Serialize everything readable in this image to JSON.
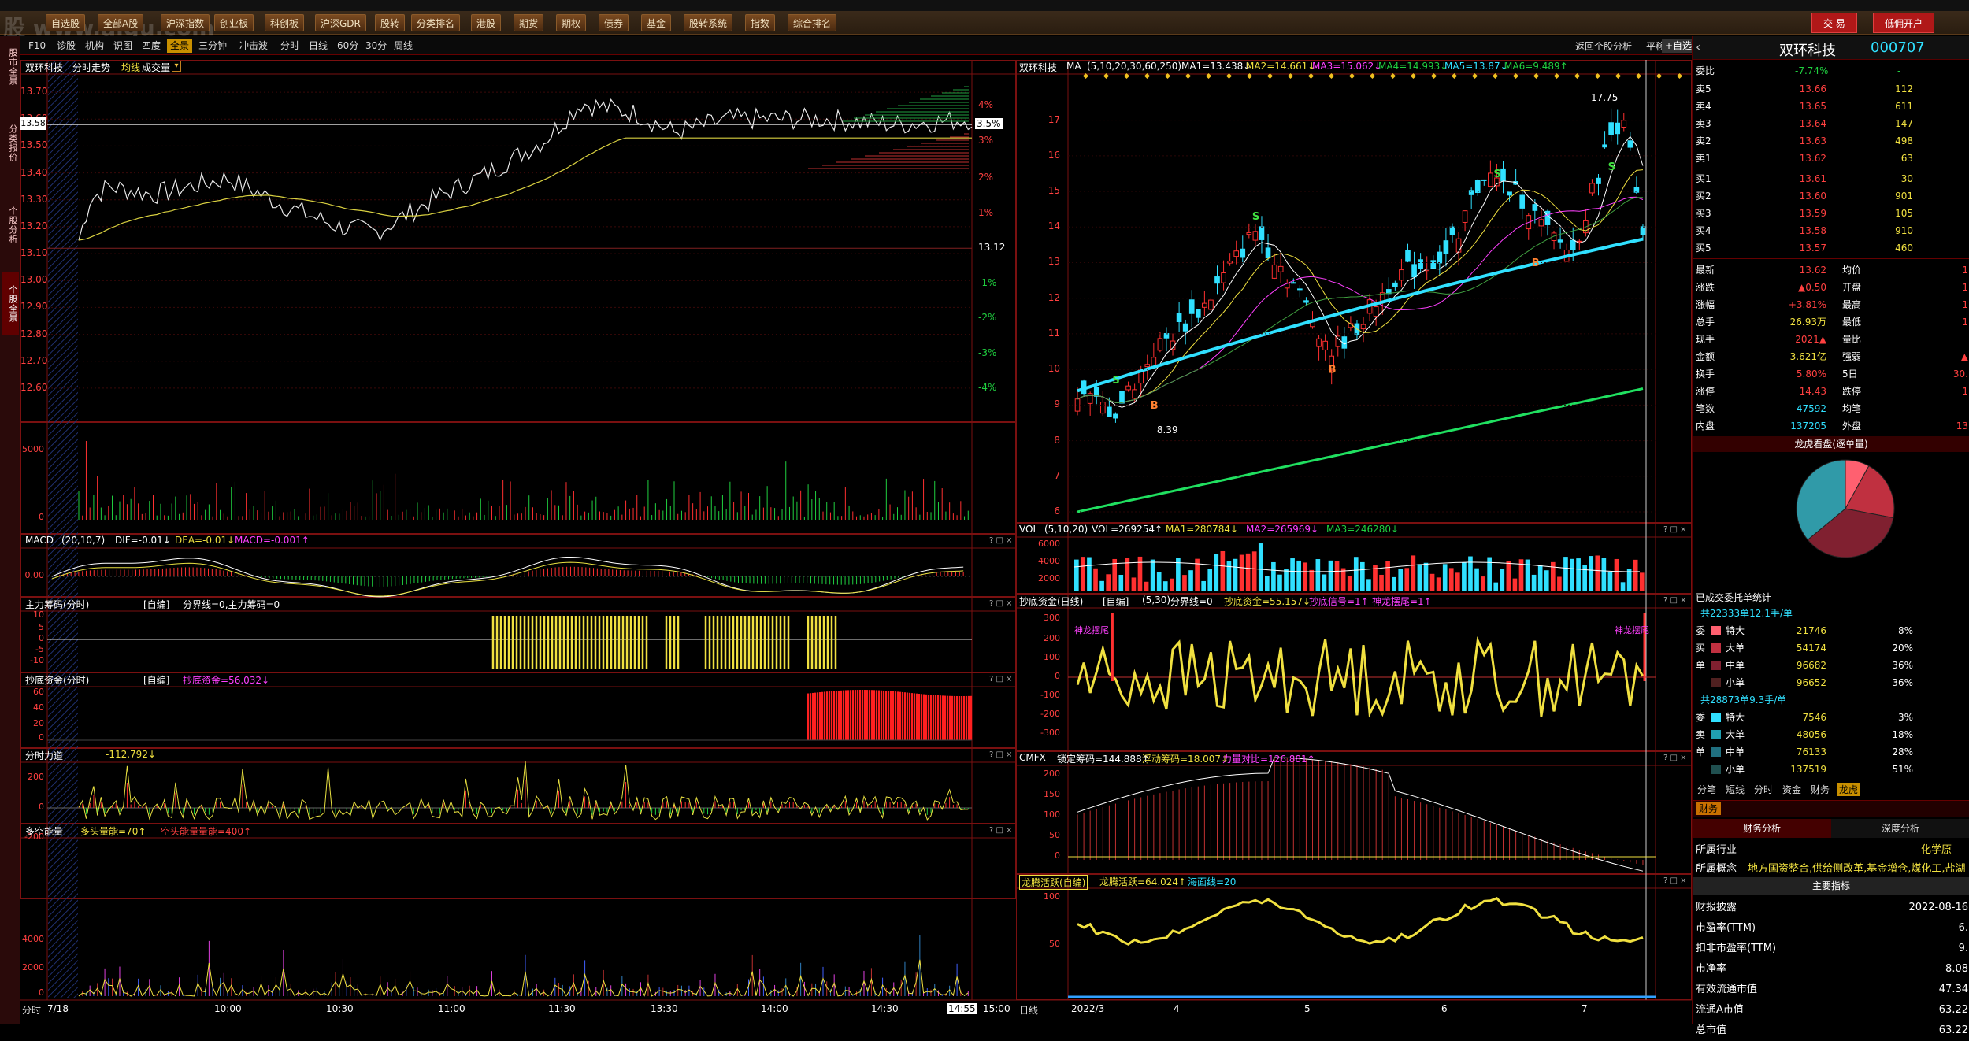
{
  "watermark": "股 www.aigu.com",
  "menubar": {
    "items": [
      "自选股",
      "全部A股",
      "沪深指数",
      "创业板",
      "科创板",
      "沪深GDR",
      "股转",
      "分类排名",
      "港股",
      "期货",
      "期权",
      "债券",
      "基金",
      "股转系统",
      "指数",
      "综合排名"
    ],
    "trade": "交 易",
    "open_account": "低佣开户"
  },
  "leftrail": [
    "股市全景",
    "分类报价",
    "个股分析",
    "个股全景"
  ],
  "tabs": {
    "items": [
      "F10",
      "诊股",
      "机构",
      "识图",
      "四度",
      "全景",
      "三分钟",
      "冲击波",
      "分时",
      "日线",
      "60分",
      "30分",
      "周线"
    ],
    "selected": "全景",
    "back_label": "返回个股分析",
    "flat_label": "平移",
    "self_select": "+自选"
  },
  "intraday": {
    "title_name": "双环科技",
    "title_type": "分时走势",
    "title_avg": "均线",
    "title_vol": "成交量",
    "price_ticks": [
      "13.70",
      "13.60",
      "13.50",
      "13.40",
      "13.30",
      "13.20",
      "13.10",
      "13.00",
      "12.90",
      "12.80",
      "12.70",
      "12.60"
    ],
    "current_price": "13.58",
    "pct_ticks": [
      "4%",
      "3.5%",
      "3%",
      "2%",
      "1%",
      "13.12",
      "-1%",
      "-2%",
      "-3%",
      "-4%"
    ],
    "vol_ticks": [
      "5000",
      "0"
    ],
    "times": [
      "7/18",
      "10:00",
      "10:30",
      "11:00",
      "11:30",
      "13:30",
      "14:00",
      "14:30",
      "14:55",
      "15:00"
    ],
    "period_label": "分时"
  },
  "macd": {
    "name": "MACD",
    "params": "(20,10,7)",
    "dif": "DIF=-0.01↓",
    "dea": "DEA=-0.01↓",
    "macd": "MACD=-0.001↑",
    "ticks": [
      "0.00"
    ]
  },
  "chip": {
    "name": "主力筹码(分时)",
    "mode": "[自编]",
    "line": "分界线=0,主力筹码=0",
    "ticks": [
      "10",
      "5",
      "0",
      "-5",
      "-10"
    ]
  },
  "bottom_fund": {
    "name": "抄底资金(分时)",
    "mode": "[自编]",
    "value": "抄底资金=56.032↓",
    "ticks": [
      "60",
      "40",
      "20",
      "0"
    ]
  },
  "force": {
    "name": "分时力道",
    "value": "-112.792↓",
    "ticks": [
      "200",
      "0",
      "-200"
    ]
  },
  "energy": {
    "name": "多空能量",
    "long": "多头量能=70↑",
    "short": "空头能量量能=400↑",
    "ticks": [
      "4000",
      "2000",
      "0"
    ]
  },
  "kline": {
    "title_name": "双环科技",
    "ma_label": "MA",
    "ma_params": "(5,10,20,30,60,250)",
    "ma1": "MA1=13.438↓",
    "ma2": "MA2=14.661↓",
    "ma3": "MA3=15.062↓",
    "ma4": "MA4=14.993↓",
    "ma5": "MA5=13.87↓",
    "ma6": "MA6=9.489↑",
    "price_ticks": [
      "17",
      "16",
      "15",
      "14",
      "13",
      "12",
      "11",
      "10",
      "9",
      "8",
      "7",
      "6"
    ],
    "high_mark": "17.75",
    "low_mark": "8.39",
    "months": [
      "2022/3",
      "4",
      "5",
      "6",
      "7"
    ],
    "period_label": "日线"
  },
  "vol": {
    "name": "VOL",
    "params": "(5,10,20)",
    "vol": "VOL=269254↑",
    "ma1": "MA1=280784↓",
    "ma2": "MA2=265969↓",
    "ma3": "MA3=246280↓",
    "ticks": [
      "6000",
      "4000",
      "2000"
    ]
  },
  "bottom_fund_day": {
    "name": "抄底资金(日线)",
    "mode": "[自编]",
    "params": "(5,30)",
    "line": "分界线=0",
    "value": "抄底资金=55.157↓",
    "signal": "抄底信号=1↑",
    "tail": "神龙摆尾=1↑",
    "ticks": [
      "300",
      "200",
      "100",
      "0",
      "-100",
      "-200",
      "-300"
    ],
    "tag": "神龙摆尾"
  },
  "cmfx": {
    "name": "CMFX",
    "lock": "锁定筹码=144.888↑",
    "float": "浮动筹码=18.007↓",
    "ratio": "力量对比=126.881↑",
    "ticks": [
      "200",
      "150",
      "100",
      "50",
      "0"
    ]
  },
  "dragon": {
    "name": "龙腾活跃(自编)",
    "value": "龙腾活跃=64.024↑",
    "sea": "海面线=20",
    "ticks": [
      "100",
      "50"
    ]
  },
  "quote": {
    "name": "双环科技",
    "code": "000707",
    "wb_label": "委比",
    "wb_value": "-7.74%",
    "wc_value": "-",
    "asks": [
      [
        "卖5",
        "13.66",
        "112"
      ],
      [
        "卖4",
        "13.65",
        "611"
      ],
      [
        "卖3",
        "13.64",
        "147"
      ],
      [
        "卖2",
        "13.63",
        "498"
      ],
      [
        "卖1",
        "13.62",
        "63"
      ]
    ],
    "bids": [
      [
        "买1",
        "13.61",
        "30"
      ],
      [
        "买2",
        "13.60",
        "901"
      ],
      [
        "买3",
        "13.59",
        "105"
      ],
      [
        "买4",
        "13.58",
        "910"
      ],
      [
        "买5",
        "13.57",
        "460"
      ]
    ],
    "stats": [
      [
        "最新",
        "13.62",
        "均价",
        "1"
      ],
      [
        "涨跌",
        "▲0.50",
        "开盘",
        "1"
      ],
      [
        "涨幅",
        "+3.81%",
        "最高",
        "1"
      ],
      [
        "总手",
        "26.93万",
        "最低",
        "1"
      ],
      [
        "现手",
        "2021▲",
        "量比",
        ""
      ],
      [
        "金额",
        "3.621亿",
        "强弱",
        "▲"
      ],
      [
        "换手",
        "5.80%",
        "5日",
        "30."
      ],
      [
        "涨停",
        "14.43",
        "跌停",
        "1"
      ],
      [
        "笔数",
        "47592",
        "均笔",
        ""
      ],
      [
        "内盘",
        "137205",
        "外盘",
        "13"
      ]
    ],
    "pie_title": "龙虎看盘(逐单量)",
    "entrust_title": "已成交委托单统计",
    "buy_total": "共22333单12.1手/单",
    "buy_rows": [
      [
        "委",
        "特大",
        "21746",
        "8%"
      ],
      [
        "买",
        "大单",
        "54174",
        "20%"
      ],
      [
        "单",
        "中单",
        "96682",
        "36%"
      ],
      [
        "",
        "小单",
        "96652",
        "36%"
      ]
    ],
    "sell_total": "共28873单9.3手/单",
    "sell_rows": [
      [
        "委",
        "特大",
        "7546",
        "3%"
      ],
      [
        "卖",
        "大单",
        "48056",
        "18%"
      ],
      [
        "单",
        "中单",
        "76133",
        "28%"
      ],
      [
        "",
        "小单",
        "137519",
        "51%"
      ]
    ],
    "subtabs": [
      "分笔",
      "短线",
      "分时",
      "资金",
      "财务",
      "龙虎"
    ],
    "fin_tab": "财务",
    "fin_tabs": [
      "财务分析",
      "深度分析"
    ],
    "industry_label": "所属行业",
    "industry": "化学原",
    "concept_label": "所属概念",
    "concept": "地方国资整合,供给侧改革,基金增仓,煤化工,盐湖",
    "main_index": "主要指标",
    "indices": [
      [
        "财报披露",
        "2022-08-16"
      ],
      [
        "市盈率(TTM)",
        "6."
      ],
      [
        "扣非市盈率(TTM)",
        "9."
      ],
      [
        "市净率",
        "8.08"
      ],
      [
        "有效流通市值",
        "47.34"
      ],
      [
        "流通A市值",
        "63.22"
      ],
      [
        "总市值",
        "63.22"
      ]
    ],
    "pie_slices": [
      8,
      20,
      36,
      36
    ],
    "pie_colors": [
      "#ff6080",
      "#c03040",
      "#802030",
      "#40a0b0"
    ]
  },
  "colors": {
    "up": "#ff3030",
    "down": "#20e040",
    "ma_cyan": "#30e0ff",
    "ma_green": "#20e060",
    "yellow": "#f0e040",
    "frame": "#7a1010"
  }
}
